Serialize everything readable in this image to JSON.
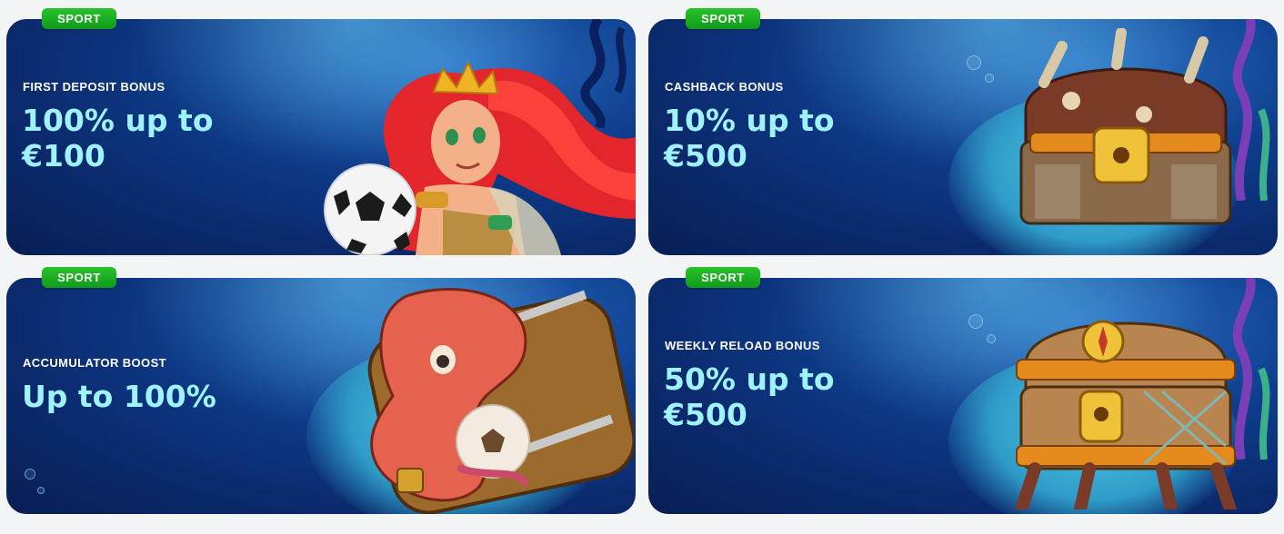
{
  "cards": [
    {
      "tag": "SPORT",
      "eyebrow": "FIRST DEPOSIT BONUS",
      "headline_line1": "100% up to",
      "headline_line2": "€100",
      "art": "mermaid-with-soccer-ball-illustration"
    },
    {
      "tag": "SPORT",
      "eyebrow": "CASHBACK BONUS",
      "headline_line1": "10% up to",
      "headline_line2": "€500",
      "art": "stone-treasure-chest-illustration"
    },
    {
      "tag": "SPORT",
      "eyebrow": "ACCUMULATOR BOOST",
      "headline_line1": "Up to 100%",
      "headline_line2": "",
      "art": "octopus-with-barrel-illustration"
    },
    {
      "tag": "SPORT",
      "eyebrow": "WEEKLY RELOAD BONUS",
      "headline_line1": "50% up to",
      "headline_line2": "€500",
      "art": "compass-treasure-chest-illustration"
    }
  ],
  "colors": {
    "tag_green": "#1bb021",
    "headline_cyan": "#9ff2ff",
    "card_navy": "#0e3d8c",
    "page_bg": "#f3f4f6"
  }
}
